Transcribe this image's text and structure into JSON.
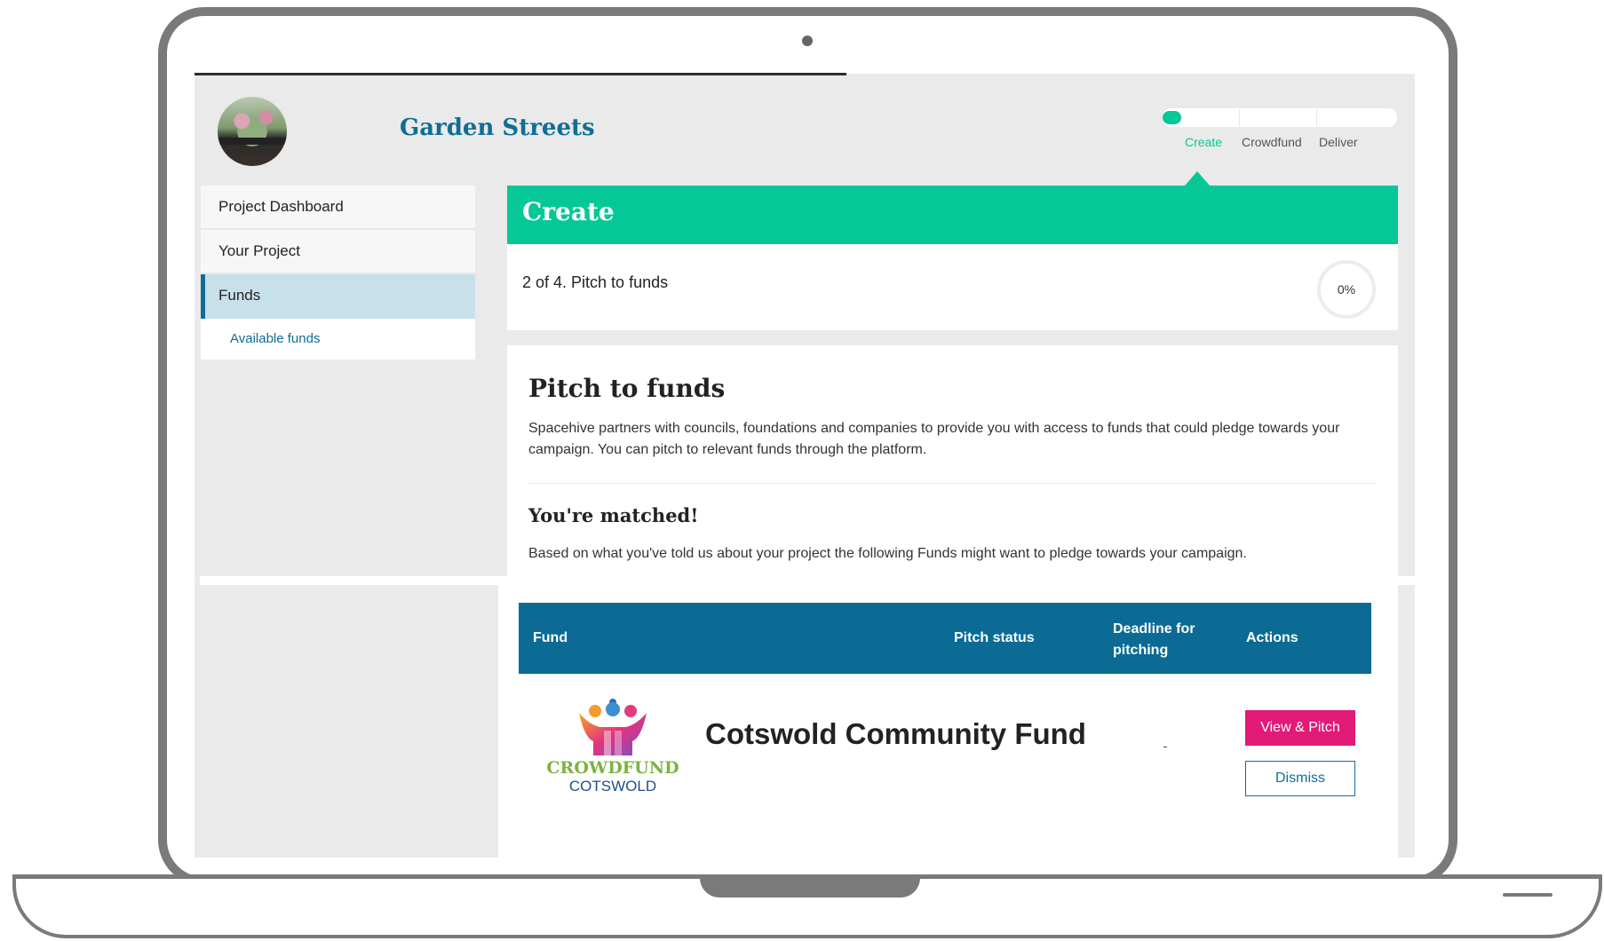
{
  "header": {
    "project_name": "Garden Streets",
    "steps": [
      "Create",
      "Crowdfund",
      "Deliver"
    ],
    "active_step": "Create",
    "step_progress": 0.08
  },
  "sidebar": {
    "items": [
      {
        "label": "Project Dashboard"
      },
      {
        "label": "Your Project"
      },
      {
        "label": "Funds"
      }
    ],
    "sub_items": [
      {
        "label": "Available funds"
      }
    ]
  },
  "create": {
    "title": "Create",
    "step_text": "2 of 4. Pitch to funds",
    "percent": "0%"
  },
  "pitch": {
    "title": "Pitch to funds",
    "description": "Spacehive partners with councils, foundations and companies to provide you with access to funds that could pledge towards your campaign. You can pitch to relevant funds through the platform.",
    "matched_title": "You're matched!",
    "matched_description": "Based on what you've told us about your project the following Funds might want to pledge towards your campaign."
  },
  "table": {
    "headers": {
      "fund": "Fund",
      "pitch_status": "Pitch status",
      "deadline": "Deadline for pitching",
      "actions": "Actions"
    },
    "rows": [
      {
        "fund_name": "Cotswold Community Fund",
        "logo_text_top": "CROWDFUND",
        "logo_text_bottom": "COTSWOLD",
        "view_pitch_label": "View & Pitch",
        "dismiss_label": "Dismiss"
      }
    ]
  },
  "colors": {
    "brand_green": "#06c896",
    "brand_blue": "#0f6e96",
    "table_header": "#0b6b94",
    "pitch_button": "#e11a77"
  }
}
